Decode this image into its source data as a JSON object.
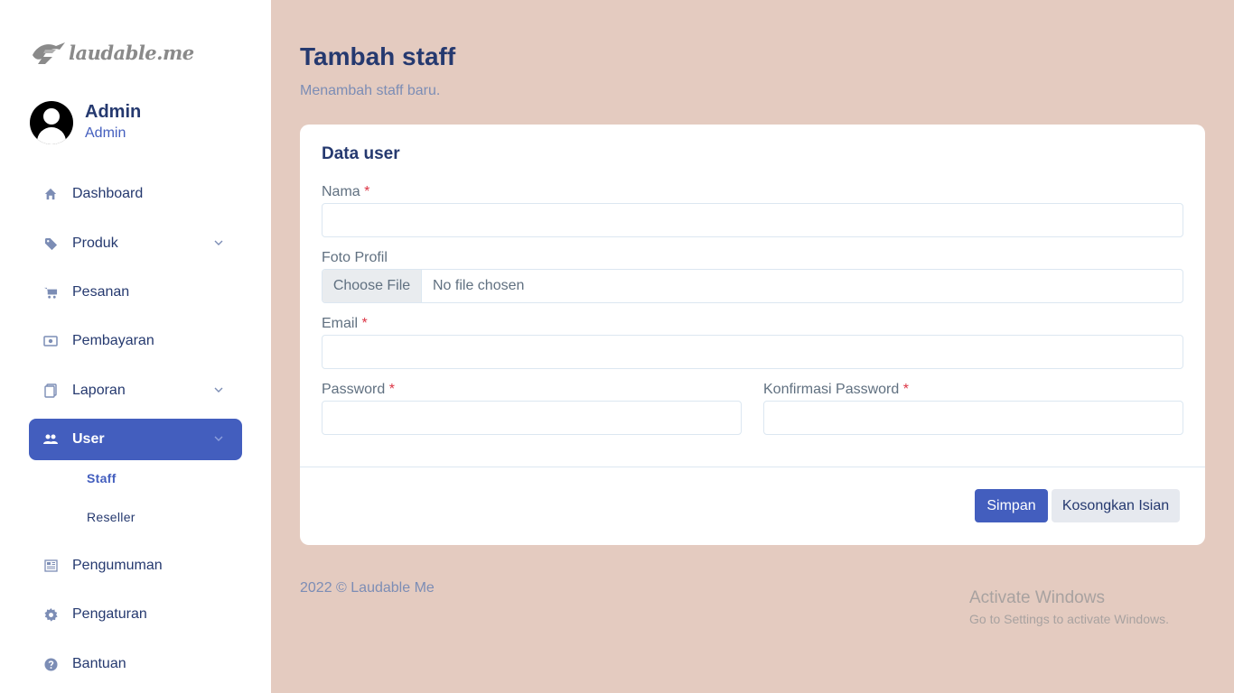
{
  "brand": {
    "logo_text": "laudable.me"
  },
  "profile": {
    "name": "Admin",
    "role": "Admin"
  },
  "sidebar": {
    "items": [
      {
        "label": "Dashboard",
        "icon": "home-icon"
      },
      {
        "label": "Produk",
        "icon": "tag-icon",
        "expandable": true
      },
      {
        "label": "Pesanan",
        "icon": "cart-icon"
      },
      {
        "label": "Pembayaran",
        "icon": "cash-icon"
      },
      {
        "label": "Laporan",
        "icon": "document-icon",
        "expandable": true
      },
      {
        "label": "User",
        "icon": "people-icon",
        "expandable": true,
        "active": true
      },
      {
        "label": "Pengumuman",
        "icon": "newspaper-icon"
      },
      {
        "label": "Pengaturan",
        "icon": "gear-icon"
      },
      {
        "label": "Bantuan",
        "icon": "question-icon"
      }
    ],
    "user_submenu": [
      {
        "label": "Staff",
        "active": true
      },
      {
        "label": "Reseller",
        "active": false
      }
    ]
  },
  "header": {
    "title": "Tambah staff",
    "subtitle": "Menambah staff baru."
  },
  "form": {
    "card_title": "Data user",
    "required_mark": "*",
    "nama_label": "Nama",
    "nama_value": "",
    "foto_label": "Foto Profil",
    "foto_button": "Choose File",
    "foto_status": "No file chosen",
    "email_label": "Email",
    "email_value": "",
    "password_label": "Password",
    "password_value": "",
    "konfirmasi_label": "Konfirmasi Password",
    "konfirmasi_value": "",
    "save_label": "Simpan",
    "reset_label": "Kosongkan Isian"
  },
  "footer": {
    "text": "2022 © Laudable Me"
  },
  "watermark": {
    "title": "Activate Windows",
    "subtitle": "Go to Settings to activate Windows."
  },
  "colors": {
    "primary": "#435ebe",
    "background": "#e4cbc0",
    "text_dark": "#25396f",
    "text_muted": "#7c8db5",
    "required": "#dc3545"
  }
}
